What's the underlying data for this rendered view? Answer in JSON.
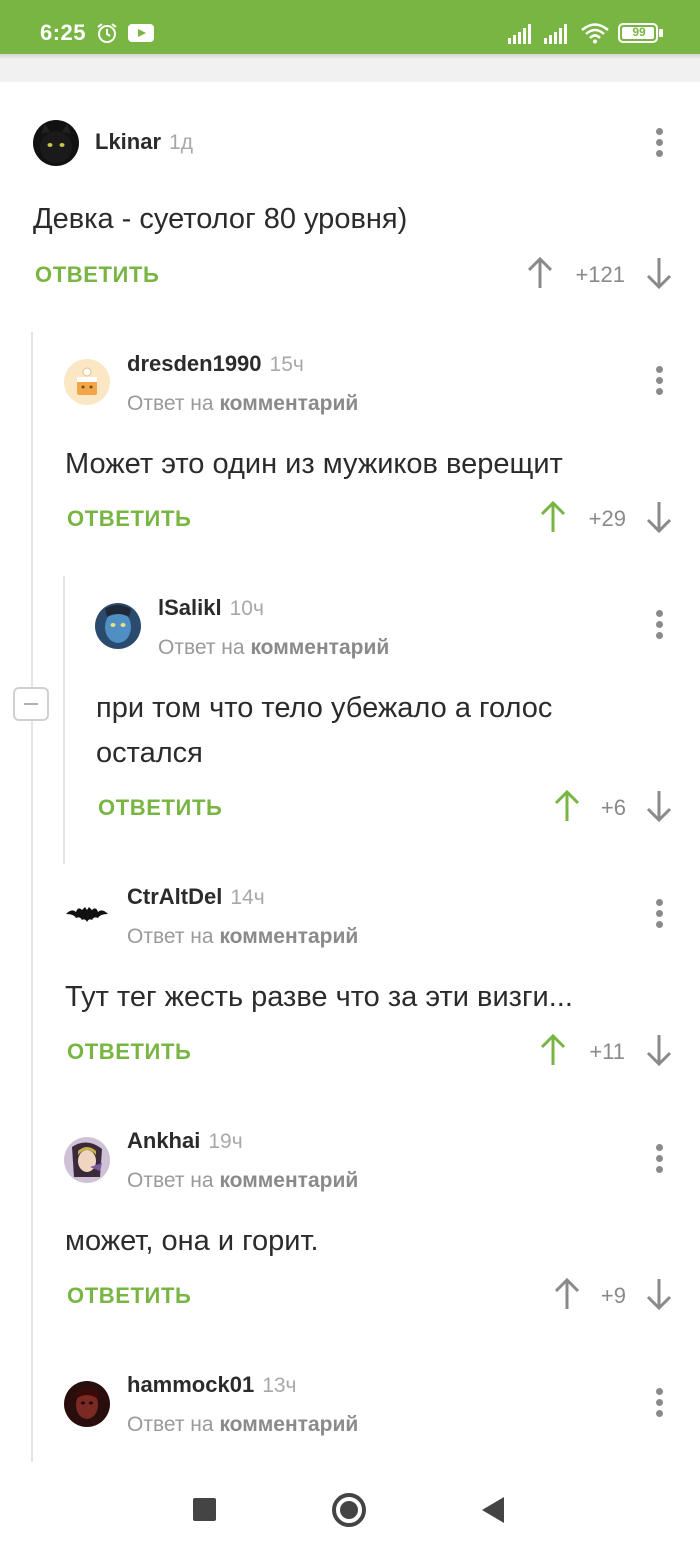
{
  "status_bar": {
    "time": "6:25",
    "battery": "99",
    "background": "#79b543"
  },
  "accent_color": "#79b543",
  "reply_label": "ОТВЕТИТЬ",
  "reply_to_prefix": "Ответ на",
  "reply_to_target": "комментарий",
  "comments": [
    {
      "author": "Lkinar",
      "age": "1д",
      "text": "Девка - суетолог 80 уровня)",
      "score": "+121",
      "upvoted": false,
      "avatar_icon": "black-cat-avatar-icon"
    },
    {
      "author": "dresden1990",
      "age": "15ч",
      "text": "Может это один из мужиков верещит",
      "score": "+29",
      "upvoted": true,
      "avatar_icon": "cake-avatar-icon"
    },
    {
      "author": "lSalikl",
      "age": "10ч",
      "text": "при том что тело убежало а голос остался",
      "score": "+6",
      "upvoted": true,
      "avatar_icon": "avatar-character-icon"
    },
    {
      "author": "CtrAltDel",
      "age": "14ч",
      "text": "Тут тег жесть разве что за эти визги...",
      "score": "+11",
      "upvoted": true,
      "avatar_icon": "bat-avatar-icon"
    },
    {
      "author": "Ankhai",
      "age": "19ч",
      "text": "может, она и горит.",
      "score": "+9",
      "upvoted": false,
      "avatar_icon": "anime-avatar-icon"
    },
    {
      "author": "hammock01",
      "age": "13ч",
      "text": "",
      "score": "",
      "upvoted": false,
      "avatar_icon": "portrait-avatar-icon"
    }
  ],
  "nav": {
    "recents_icon": "square-icon",
    "home_icon": "circle-icon",
    "back_icon": "triangle-back-icon"
  }
}
